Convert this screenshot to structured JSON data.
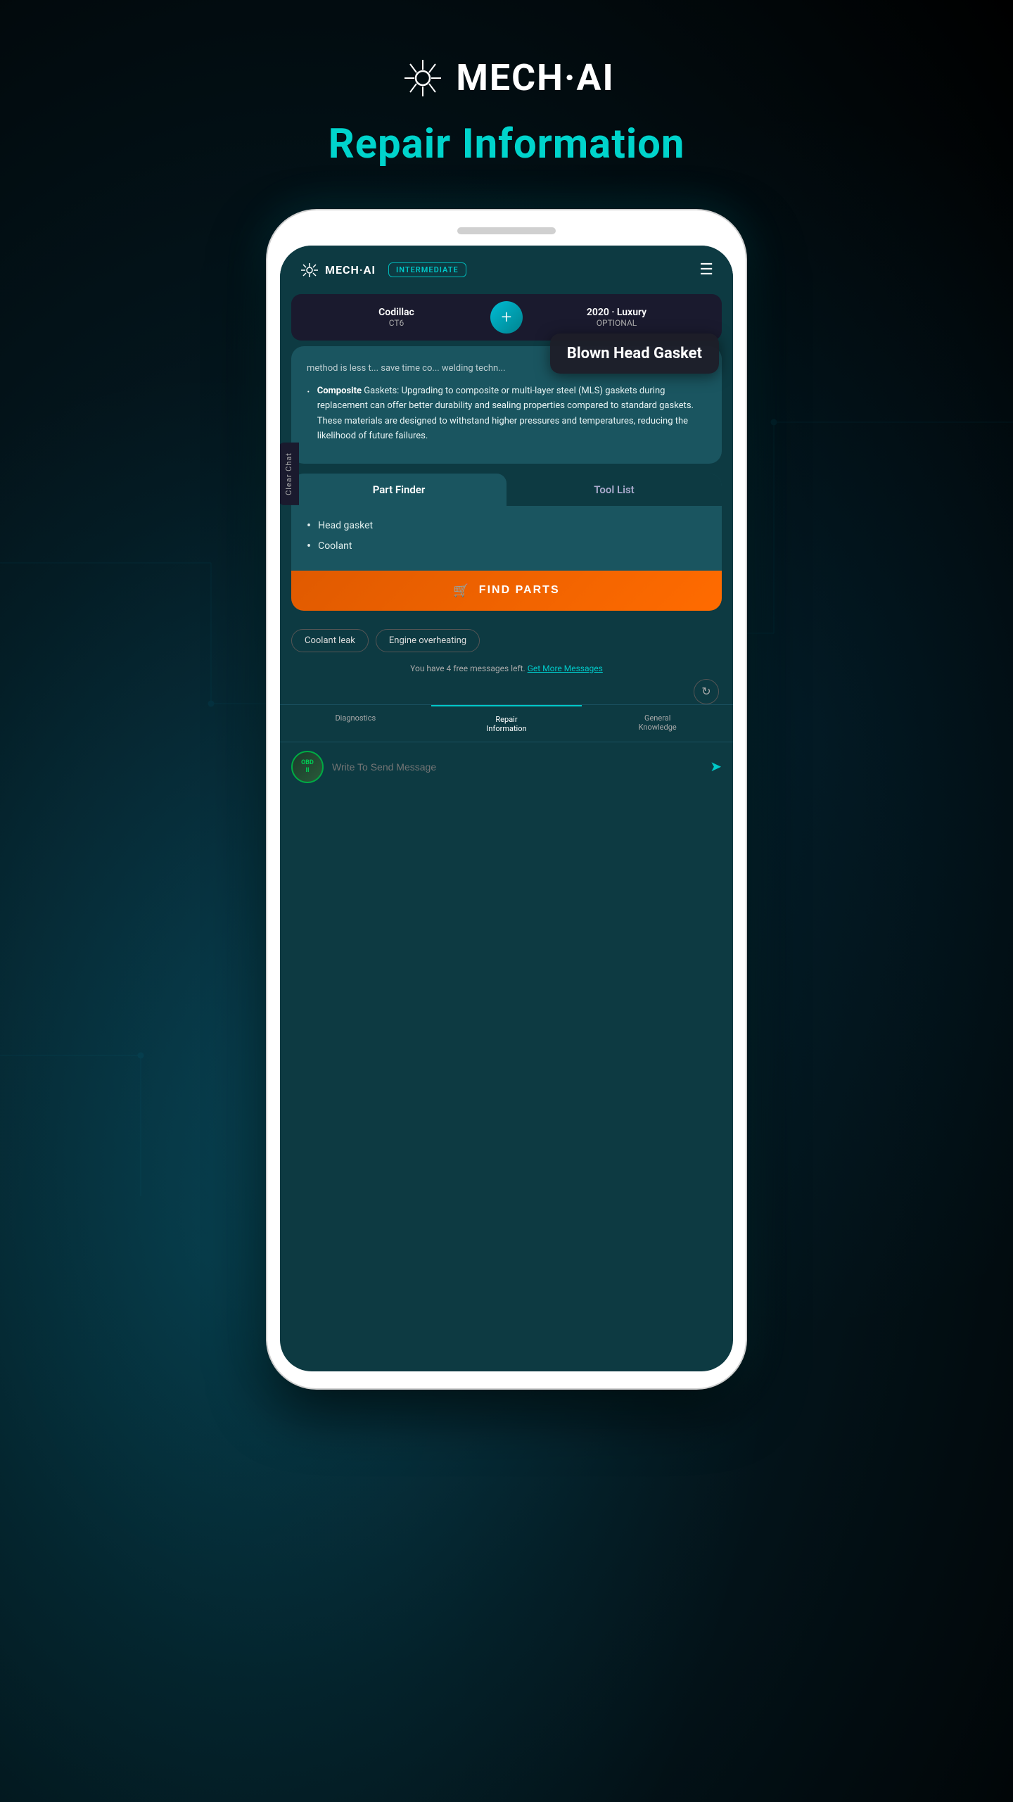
{
  "app": {
    "logo_text": "MECH·AI",
    "page_title": "Repair Information"
  },
  "header": {
    "logo_text": "MECH·AI",
    "badge_text": "INTERMEDIATE",
    "hamburger_label": "≡"
  },
  "car_selector": {
    "left_name": "Codillac",
    "left_model": "CT6",
    "add_button_label": "+",
    "right_year": "2020 · Luxury",
    "right_trim": "OPTIONAL"
  },
  "sidebar_label": "Clear Chat",
  "tooltip": {
    "text": "Blown Head Gasket"
  },
  "message": {
    "fade_text": "method is less t... save time co... welding techn...",
    "bullet_label": "Composite",
    "bullet_rest": " Gaskets:",
    "bullet_detail": " Upgrading to composite or multi-layer steel (MLS) gaskets during replacement can offer better durability and sealing properties compared to standard gaskets. These materials are designed to withstand higher pressures and temperatures, reducing the likelihood of future failures."
  },
  "parts_card": {
    "tab1_label": "Part Finder",
    "tab2_label": "Tool List",
    "parts_list": [
      "Head gasket",
      "Coolant"
    ],
    "find_parts_button": "FIND PARTS"
  },
  "suggestions": {
    "chip1": "Coolant leak",
    "chip2": "Engine overheating"
  },
  "free_messages": {
    "text": "You have 4 free messages left.",
    "link_text": "Get More Messages"
  },
  "bottom_nav": {
    "item1": "Diagnostics",
    "item2_line1": "Repair",
    "item2_line2": "Information",
    "item3_line1": "General",
    "item3_line2": "Knowledge"
  },
  "input": {
    "placeholder": "Write To Send Message",
    "obd_label": "OBD",
    "send_icon": "➤"
  }
}
